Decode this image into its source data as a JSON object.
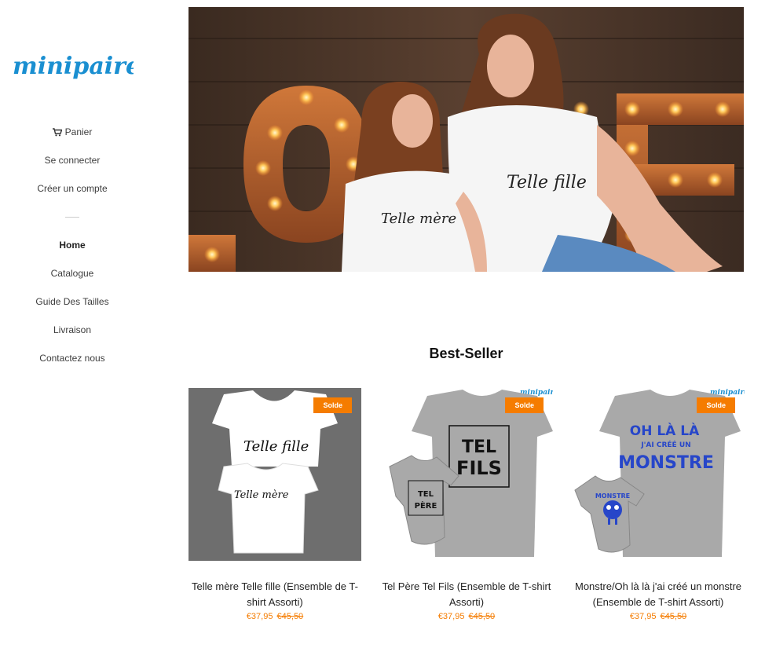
{
  "brand": {
    "logo_text": "minipaire"
  },
  "nav": {
    "cart": "Panier",
    "login": "Se connecter",
    "register": "Créer un compte",
    "items": [
      {
        "label": "Home",
        "active": true
      },
      {
        "label": "Catalogue"
      },
      {
        "label": "Guide Des Tailles"
      },
      {
        "label": "Livraison"
      },
      {
        "label": "Contactez nous"
      }
    ]
  },
  "hero": {
    "shirt_text_mother": "Telle fille",
    "shirt_text_daughter": "Telle mère"
  },
  "best_seller": {
    "title": "Best-Seller",
    "products": [
      {
        "badge": "Solde",
        "title": "Telle mère Telle fille (Ensemble de T-shirt Assorti)",
        "price": "€37,95",
        "old_price": "€45,50",
        "print_top": "Telle fille",
        "print_bottom": "Telle mère"
      },
      {
        "badge": "Solde",
        "title": "Tel Père Tel Fils (Ensemble de T-shirt Assorti)",
        "price": "€37,95",
        "old_price": "€45,50",
        "print_big_1": "TEL",
        "print_big_2": "FILS",
        "print_small_1": "TEL",
        "print_small_2": "PÈRE",
        "watermark": "minipaire"
      },
      {
        "badge": "Solde",
        "title": "Monstre/Oh là là j'ai créé un monstre (Ensemble de T-shirt Assorti)",
        "price": "€37,95",
        "old_price": "€45,50",
        "print_line_1": "OH LÀ LÀ",
        "print_line_2": "J'AI CRÉÉ UN",
        "print_line_3": "MONSTRE",
        "print_small": "MONSTRE",
        "watermark": "minipaire"
      }
    ]
  },
  "colors": {
    "accent": "#f57c00",
    "logo": "#1a8fd1",
    "print_blue": "#2746c9"
  }
}
